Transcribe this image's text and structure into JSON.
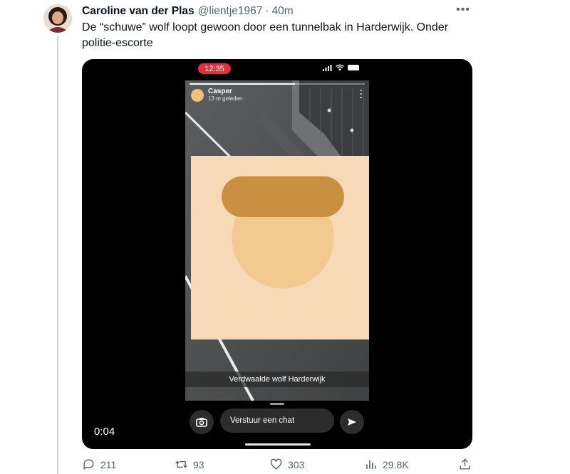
{
  "tweet": {
    "author_name": "Caroline van der Plas",
    "handle": "@lientje1967",
    "separator": "·",
    "time_ago": "40m",
    "more_icon": "more-horizontal-icon",
    "text": "De “schuwe” wolf loopt gewoon door een tunnelbak in Harderwijk. Onder politie-escorte"
  },
  "video": {
    "duration": "0:04",
    "phone_status_time": "12:35",
    "story_user": "Casper",
    "story_time": "13 m geleden",
    "story_caption": "Verdwaalde wolf Harderwijk",
    "chat_placeholder": "Verstuur een chat",
    "story_progress": 0.6,
    "colors": {
      "status_pill": "#e5303a",
      "vest": "#d7f02a"
    }
  },
  "actions": {
    "replies": "211",
    "retweets": "93",
    "likes": "303",
    "views": "29.8K"
  },
  "colors": {
    "text_primary": "#0f1419",
    "text_secondary": "#536471",
    "thread_line": "#cfd9de"
  }
}
